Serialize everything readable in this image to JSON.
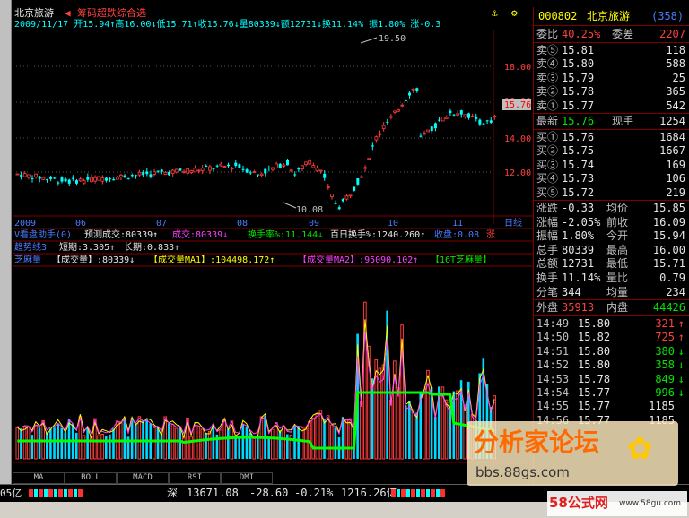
{
  "header": {
    "name": "北京旅游",
    "sub": "筹码超跌综合选",
    "ohlc": "2009/11/17 开15.94↑高16.00↓低15.71↑收15.76↓量80339↓额12731↓换11.14% 振1.80% 涨-0.3",
    "price_high_label": "19.50",
    "price_low_label": "10.08",
    "axis_labels": [
      "18.00",
      "16.00",
      "14.00",
      "12.00"
    ],
    "last_price": "15.76",
    "months": [
      "2009",
      "06",
      "07",
      "08",
      "09",
      "10",
      "11"
    ],
    "dayline": "日线"
  },
  "indicators": {
    "vline": "V看盘助手(0)",
    "vparts": [
      "预测成交:80339↑",
      "成交:80339↓",
      "换手率%:11.144↓",
      "百日换手%:1240.260↑",
      "收盘:0.08",
      "涨"
    ],
    "trend": "趋势线3",
    "trendparts": [
      "短期:3.305↑",
      "长期:0.833↑"
    ],
    "vol_title": "芝麻量",
    "vol_parts": [
      "【成交量】:80339↓",
      "【成交量MA1】:104498.172↑",
      "【成交量MA2】:95090.102↑",
      "【16T芝麻量】"
    ]
  },
  "tabs": [
    "MA",
    "BOLL",
    "MACD",
    "RSI",
    "DMI"
  ],
  "right": {
    "code": "000802",
    "name": "北京旅游",
    "badge": "(358)",
    "wbi": "委比",
    "wbi_val": "40.25%",
    "wcha": "委差",
    "wcha_val": "2207",
    "sells": [
      {
        "lab": "卖⑤",
        "p": "15.81",
        "v": "118"
      },
      {
        "lab": "卖④",
        "p": "15.80",
        "v": "588"
      },
      {
        "lab": "卖③",
        "p": "15.79",
        "v": "25"
      },
      {
        "lab": "卖②",
        "p": "15.78",
        "v": "365"
      },
      {
        "lab": "卖①",
        "p": "15.77",
        "v": "542"
      }
    ],
    "last_lab": "最新",
    "last_val": "15.76",
    "now_lab": "现手",
    "now_val": "1254",
    "buys": [
      {
        "lab": "买①",
        "p": "15.76",
        "v": "1684"
      },
      {
        "lab": "买②",
        "p": "15.75",
        "v": "1667"
      },
      {
        "lab": "买③",
        "p": "15.74",
        "v": "169"
      },
      {
        "lab": "买④",
        "p": "15.73",
        "v": "106"
      },
      {
        "lab": "买⑤",
        "p": "15.72",
        "v": "219"
      }
    ],
    "stats": [
      {
        "a": "涨跌",
        "av": "-0.33",
        "b": "均价",
        "bv": "15.85"
      },
      {
        "a": "涨幅",
        "av": "-2.05%",
        "b": "前收",
        "bv": "16.09"
      },
      {
        "a": "振幅",
        "av": "1.80%",
        "b": "今开",
        "bv": "15.94"
      },
      {
        "a": "总手",
        "av": "80339",
        "b": "最高",
        "bv": "16.00"
      },
      {
        "a": "总额",
        "av": "12731",
        "b": "最低",
        "bv": "15.71"
      },
      {
        "a": "换手",
        "av": "11.14%",
        "b": "量比",
        "bv": "0.79"
      },
      {
        "a": "分笔",
        "av": "344",
        "b": "均量",
        "bv": "234"
      }
    ],
    "outer_lab": "外盘",
    "outer_val": "35913",
    "inner_lab": "内盘",
    "inner_val": "44426",
    "ticks": [
      {
        "t": "14:49",
        "p": "15.80",
        "v": "321",
        "a": "↑"
      },
      {
        "t": "14:50",
        "p": "15.82",
        "v": "725",
        "a": "↑"
      },
      {
        "t": "14:51",
        "p": "15.80",
        "v": "380",
        "a": "↓"
      },
      {
        "t": "14:52",
        "p": "15.80",
        "v": "358",
        "a": "↓"
      },
      {
        "t": "14:53",
        "p": "15.78",
        "v": "849",
        "a": "↓"
      },
      {
        "t": "14:54",
        "p": "15.77",
        "v": "996",
        "a": "↓"
      },
      {
        "t": "14:55",
        "p": "15.77",
        "v": "1185",
        "a": ""
      },
      {
        "t": "14:56",
        "p": "15.77",
        "v": "1185",
        "a": ""
      }
    ]
  },
  "bottom": {
    "left_frag": "05亿",
    "sz_lab": "深",
    "sz_val": "13671.08",
    "sz_chg": "-28.60",
    "sz_pct": "-0.21%",
    "sz_amt": "1216.26亿"
  },
  "watermark": {
    "title": "分析家论坛",
    "url": "bbs.88gs.com",
    "brand": "58公式网",
    "brand_url": "www.58gu.com"
  }
}
